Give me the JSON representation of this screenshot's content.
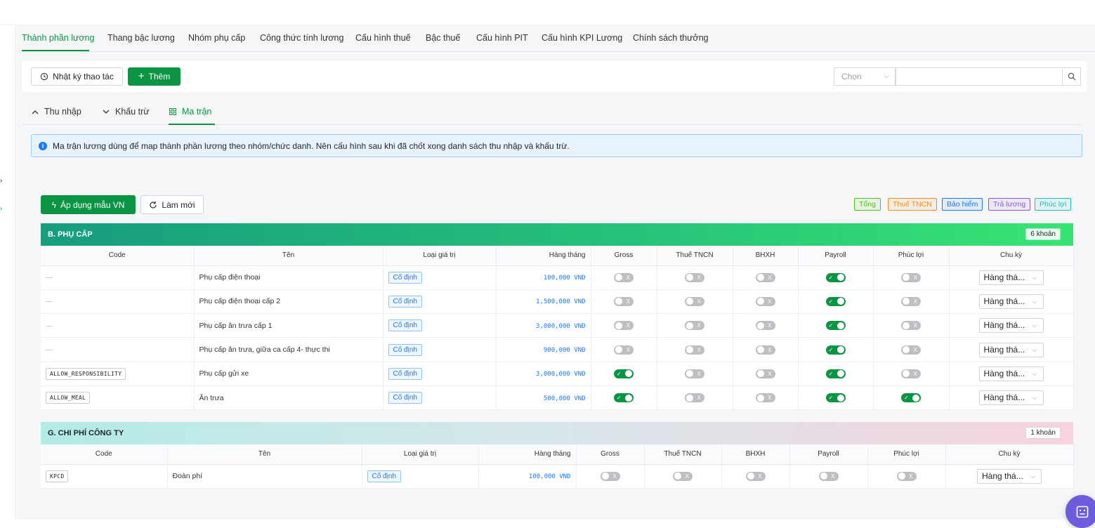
{
  "tabs": [
    "Thành phần lương",
    "Thang bậc lương",
    "Nhóm phụ cấp",
    "Công thức tính lương",
    "Cấu hình thuế",
    "Bậc thuế",
    "Cấu hình PIT",
    "Cấu hình KPI Lương",
    "Chính sách thưởng"
  ],
  "toolbar": {
    "log_label": "Nhật ký thao tác",
    "add_label": "Thêm",
    "select_placeholder": "Chọn",
    "search_value": ""
  },
  "subtabs": [
    "Thu nhập",
    "Khấu trừ",
    "Ma trận"
  ],
  "info_text": "Ma trận lương dùng để map thành phần lương theo nhóm/chức danh. Nên cấu hình sau khi đã chốt xong danh sách thu nhập và khấu trừ.",
  "actions": {
    "apply_label": "Áp dụng mẫu VN",
    "refresh_label": "Làm mới"
  },
  "legend": [
    {
      "label": "Tổng",
      "color": "#52c41a"
    },
    {
      "label": "Thuế TNCN",
      "color": "#fa8c16"
    },
    {
      "label": "Bảo hiểm",
      "color": "#1677ff"
    },
    {
      "label": "Trả lương",
      "color": "#9254de"
    },
    {
      "label": "Phúc lợi",
      "color": "#13c2c2"
    }
  ],
  "columns": [
    "Code",
    "Tên",
    "Loại giá trị",
    "Hàng tháng",
    "Gross",
    "Thuế TNCN",
    "BHXH",
    "Payroll",
    "Phúc lợi",
    "Chu kỳ"
  ],
  "section_b": {
    "title": "B. PHỤ CẤP",
    "count": "6 khoản",
    "rows": [
      {
        "code": "—",
        "name": "Phụ cấp điện thoại",
        "type": "Cố định",
        "monthly": "100,000 VNĐ",
        "gross": false,
        "tax": false,
        "bhxh": false,
        "payroll": true,
        "welfare": false,
        "cycle": "Hàng thá..."
      },
      {
        "code": "—",
        "name": "Phụ cấp điện thoại cấp 2",
        "type": "Cố định",
        "monthly": "1,500,000 VNĐ",
        "gross": false,
        "tax": false,
        "bhxh": false,
        "payroll": true,
        "welfare": false,
        "cycle": "Hàng thá..."
      },
      {
        "code": "—",
        "name": "Phụ cấp ăn trưa cấp 1",
        "type": "Cố định",
        "monthly": "3,000,000 VNĐ",
        "gross": false,
        "tax": false,
        "bhxh": false,
        "payroll": true,
        "welfare": false,
        "cycle": "Hàng thá..."
      },
      {
        "code": "—",
        "name": "Phụ cấp ăn trưa, giữa ca cấp 4- thực thi",
        "type": "Cố định",
        "monthly": "900,000 VNĐ",
        "gross": false,
        "tax": false,
        "bhxh": false,
        "payroll": true,
        "welfare": false,
        "cycle": "Hàng thá..."
      },
      {
        "code": "ALLOW_RESPONSIBILITY",
        "name": "Phụ cấp gửi xe",
        "type": "Cố định",
        "monthly": "3,000,000 VNĐ",
        "gross": true,
        "tax": false,
        "bhxh": false,
        "payroll": true,
        "welfare": false,
        "cycle": "Hàng thá..."
      },
      {
        "code": "ALLOW_MEAL",
        "name": "Ăn trưa",
        "type": "Cố định",
        "monthly": "500,000 VNĐ",
        "gross": true,
        "tax": false,
        "bhxh": false,
        "payroll": true,
        "welfare": true,
        "cycle": "Hàng thá..."
      }
    ]
  },
  "section_g": {
    "title": "G. CHI PHÍ CÔNG TY",
    "count": "1 khoản",
    "rows": [
      {
        "code": "KPCD",
        "name": "Đoàn phí",
        "type": "Cố định",
        "monthly": "100,000 VNĐ",
        "gross": false,
        "tax": false,
        "bhxh": false,
        "payroll": false,
        "welfare": false,
        "cycle": "Hàng thá..."
      }
    ]
  },
  "toggle_marks": {
    "on": "✓",
    "off": "X"
  }
}
